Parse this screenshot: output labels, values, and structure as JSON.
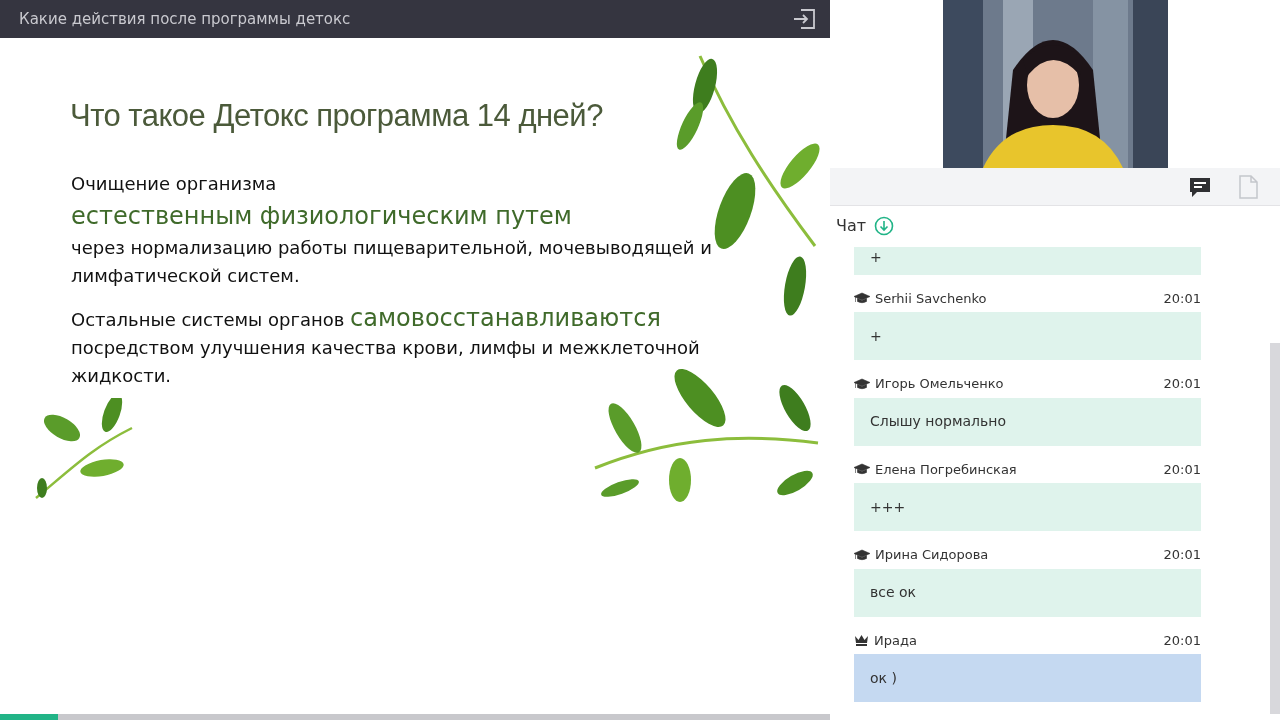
{
  "header": {
    "title": "Какие действия после программы детокс"
  },
  "slide": {
    "title": "Что такое Детокс программа 14 дней?",
    "paragraph_1": [
      {
        "text": "Очищение организма",
        "emphasis": false
      },
      {
        "text": "естественным физиологическим путем",
        "emphasis": true
      },
      {
        "text": "через нормализацию работы пищеварительной, мочевыводящей и лимфатической систем.",
        "emphasis": false
      }
    ],
    "paragraph_2": "Остальные системы органов **самовосстанавливаются** посредством улучшения качества крови, лимфы и межклеточной жидкости."
  },
  "progress": {
    "level": 0.07
  },
  "toolbar": [
    {
      "kind": "chat",
      "selected": true
    },
    {
      "kind": "files",
      "selected": false
    }
  ],
  "chat": {
    "title": "Чат",
    "messages": [
      {
        "kind": "student",
        "text": "+"
      },
      {
        "kind": "student",
        "author": "Serhii Savchenko",
        "time": "20:01",
        "text": "+"
      },
      {
        "kind": "student",
        "author": "Игорь Омельченко",
        "time": "20:01",
        "text": "Слышу нормально"
      },
      {
        "kind": "student",
        "author": "Елена Погребинская",
        "time": "20:01",
        "text": "+++"
      },
      {
        "kind": "student",
        "author": "Ирина Сидорова",
        "time": "20:01",
        "text": "все ок"
      },
      {
        "kind": "host",
        "author": "Ирада",
        "time": "20:01",
        "text": "ок )"
      }
    ]
  }
}
